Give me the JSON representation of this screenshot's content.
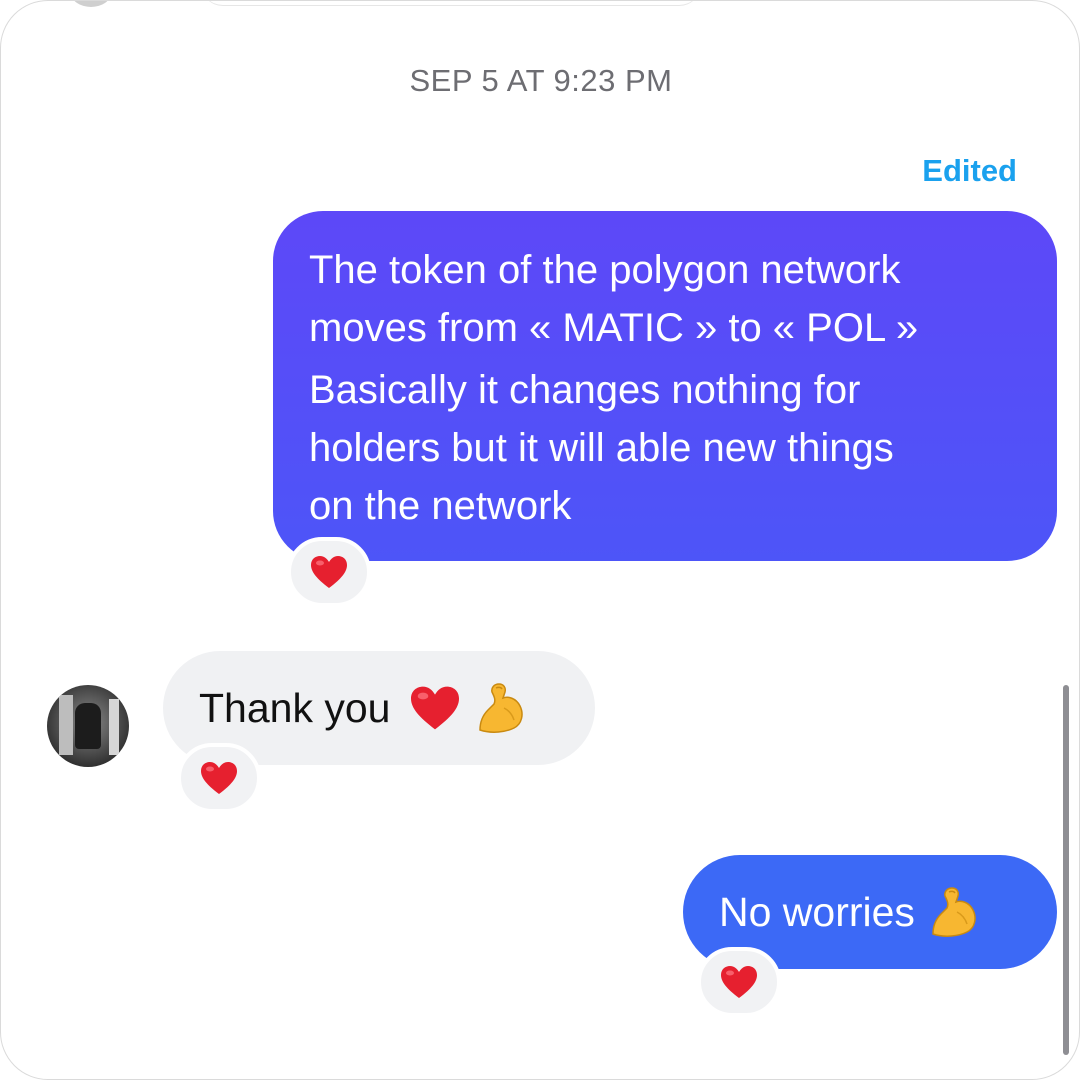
{
  "conversation": {
    "timestamp": "SEP 5 AT 9:23 PM",
    "edited_label": "Edited",
    "messages": [
      {
        "sender": "me",
        "lines": [
          "The token of the polygon network",
          "moves from « MATIC » to « POL »",
          "Basically it changes nothing for",
          "holders but it will able new things",
          "on the network"
        ],
        "reaction": "red-heart",
        "color": "#5a4cf8"
      },
      {
        "sender": "other",
        "text": "Thank you",
        "emojis": [
          "red-heart",
          "flexed-biceps"
        ],
        "reaction": "red-heart",
        "color": "#f0f1f3"
      },
      {
        "sender": "me",
        "text": "No worries",
        "emojis": [
          "flexed-biceps"
        ],
        "reaction": "red-heart",
        "color": "#3c69f6"
      }
    ]
  },
  "colors": {
    "edited": "#1aa1ee",
    "timestamp": "#6d6d72",
    "reaction_bg": "#f1f2f4"
  }
}
